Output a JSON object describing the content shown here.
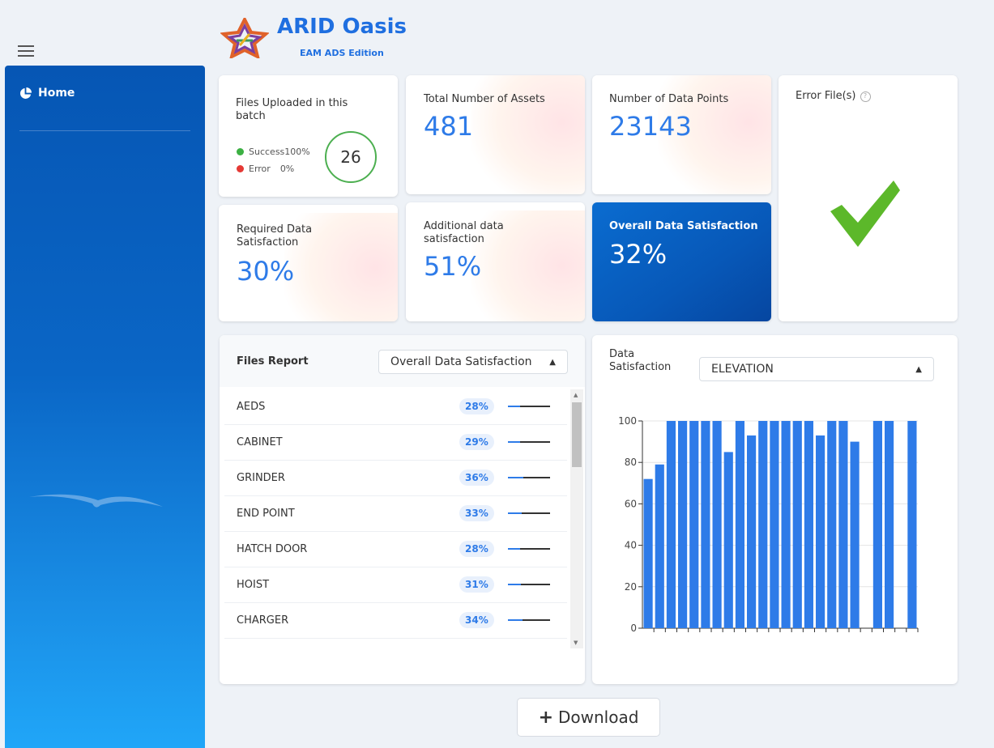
{
  "app": {
    "title": "ARID Oasis",
    "subtitle": "EAM ADS Edition"
  },
  "sidebar": {
    "items": [
      {
        "label": "Home",
        "icon": "pie-chart-icon"
      }
    ]
  },
  "cards": {
    "files_uploaded": {
      "title": "Files Uploaded in this batch",
      "count": "26",
      "success_label": "Success",
      "success_value": "100%",
      "error_label": "Error",
      "error_value": "0%",
      "success_color": "#3cb043",
      "error_color": "#e53935"
    },
    "total_assets": {
      "title": "Total Number of Assets",
      "value": "481"
    },
    "data_points": {
      "title": "Number of Data Points",
      "value": "23143"
    },
    "error_files": {
      "title": "Error File(s)",
      "status_icon": "check-icon"
    },
    "required": {
      "title": "Required Data Satisfaction",
      "value": "30%"
    },
    "additional": {
      "title": "Additional data satisfaction",
      "value": "51%"
    },
    "overall": {
      "title": "Overall Data Satisfaction",
      "value": "32%"
    }
  },
  "files_report": {
    "title": "Files Report",
    "selected": "Overall Data Satisfaction",
    "rows": [
      {
        "name": "AEDS",
        "percent": "28%",
        "fraction": 0.28
      },
      {
        "name": "CABINET",
        "percent": "29%",
        "fraction": 0.29
      },
      {
        "name": "GRINDER",
        "percent": "36%",
        "fraction": 0.36
      },
      {
        "name": "END POINT",
        "percent": "33%",
        "fraction": 0.33
      },
      {
        "name": "HATCH DOOR",
        "percent": "28%",
        "fraction": 0.28
      },
      {
        "name": "HOIST",
        "percent": "31%",
        "fraction": 0.31
      },
      {
        "name": "CHARGER",
        "percent": "34%",
        "fraction": 0.34
      }
    ]
  },
  "data_satisfaction": {
    "title": "Data Satisfaction",
    "selected": "ELEVATION"
  },
  "chart_data": {
    "type": "bar",
    "ylim": [
      0,
      100
    ],
    "yticks": [
      "0",
      "20",
      "40",
      "60",
      "80",
      "100"
    ],
    "values": [
      72,
      79,
      100,
      100,
      100,
      100,
      100,
      85,
      100,
      93,
      100,
      100,
      100,
      100,
      100,
      93,
      100,
      100,
      90,
      0,
      100,
      100,
      0,
      100
    ],
    "color": "#2e7be8",
    "grid": true
  },
  "download": {
    "label": "Download"
  }
}
